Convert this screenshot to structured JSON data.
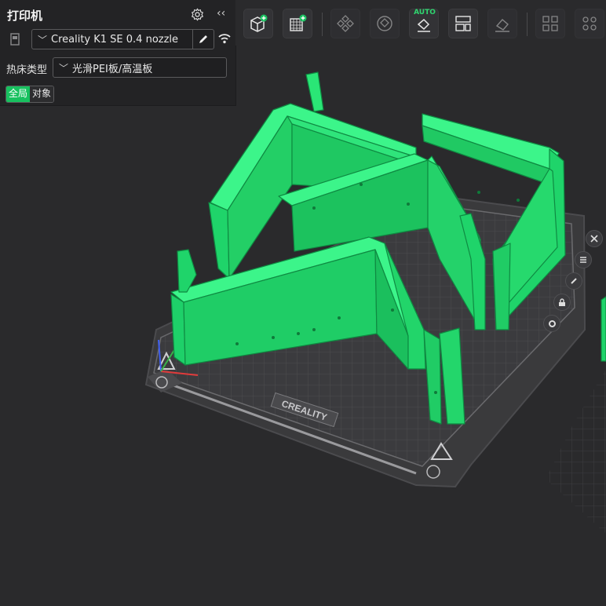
{
  "printer_panel": {
    "title": "打印机",
    "printer_name": "Creality K1 SE 0.4 nozzle",
    "bed_type_label": "热床类型",
    "bed_type_value": "光滑PEI板/高温板",
    "scope_toggle": {
      "global": "全局",
      "object": "对象"
    }
  },
  "toolbar": {
    "buttons": [
      {
        "name": "add-object",
        "icon": "cube-plus-icon"
      },
      {
        "name": "add-plate",
        "icon": "plate-plus-icon"
      },
      {
        "name": "arrange",
        "icon": "arrange-icon"
      },
      {
        "name": "orient",
        "icon": "orient-icon"
      },
      {
        "name": "auto-orient",
        "icon": "auto-icon",
        "label": "AUTO"
      },
      {
        "name": "layout",
        "icon": "layout-icon"
      },
      {
        "name": "split",
        "icon": "split-icon"
      },
      {
        "name": "split-parts",
        "icon": "parts-icon"
      },
      {
        "name": "more",
        "icon": "dots-icon"
      }
    ]
  },
  "plate": {
    "brand": "CREALITY"
  },
  "colors": {
    "accent": "#17c15f",
    "model": "#1ed56a",
    "background": "#2a2a2c"
  }
}
